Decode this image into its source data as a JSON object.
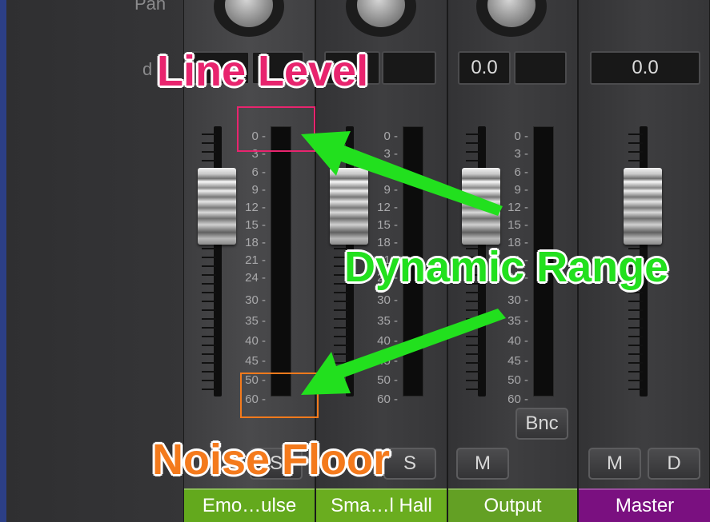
{
  "labels": {
    "pan": "Pan",
    "db": "d"
  },
  "channels": [
    {
      "name": "Emo…ulse",
      "value_left": "",
      "value_right": "",
      "buttons": [
        "S"
      ],
      "name_color": "#63a91d"
    },
    {
      "name": "Sma…l Hall",
      "value_left": "",
      "value_right": "",
      "buttons": [
        "S"
      ],
      "name_color": "#6aad1f"
    },
    {
      "name": "Output",
      "value_left": "0.0",
      "value_right": "",
      "buttons": [
        "M"
      ],
      "bounce": "Bnc",
      "name_color": "#63a024"
    },
    {
      "name": "Master",
      "value": "0.0",
      "buttons": [
        "M",
        "D"
      ],
      "name_color": "#7a1080"
    }
  ],
  "meter_scale": [
    "0",
    "3",
    "6",
    "9",
    "12",
    "15",
    "18",
    "21",
    "24",
    "30",
    "35",
    "40",
    "45",
    "50",
    "60"
  ],
  "annotations": {
    "line_level": "Line Level",
    "dynamic_range": "Dynamic Range",
    "noise_floor": "Noise Floor",
    "colors": {
      "line_level": "#e8246e",
      "dynamic_range": "#22e01e",
      "noise_floor": "#f47a1c"
    }
  }
}
